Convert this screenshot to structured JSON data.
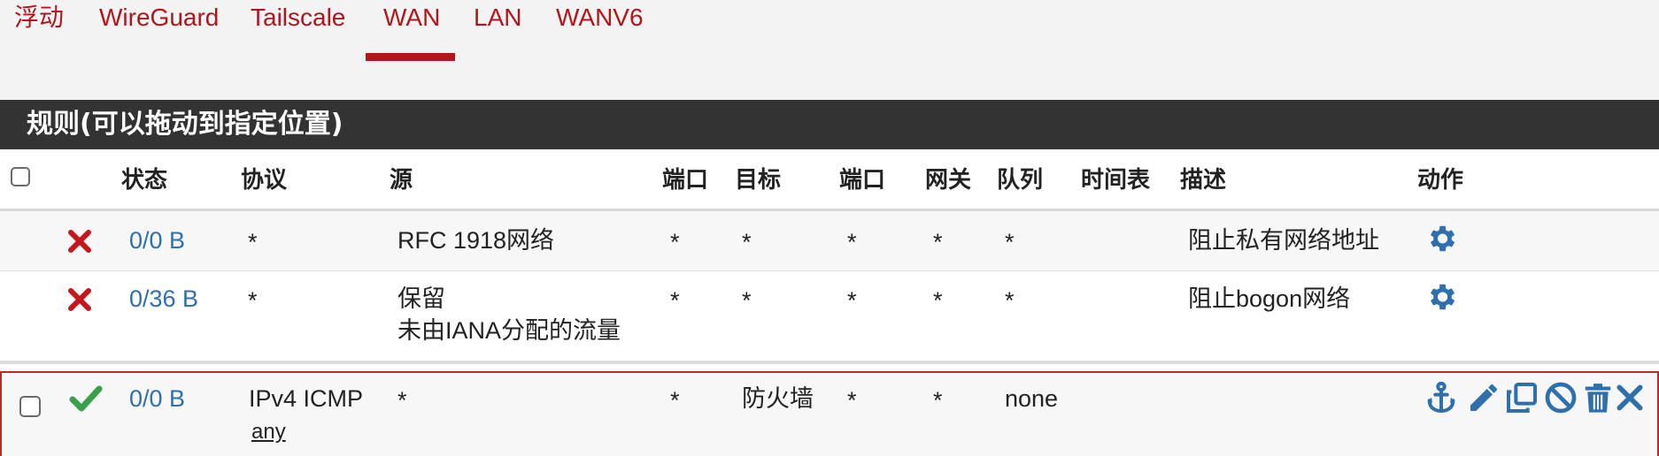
{
  "tabs": [
    {
      "label": "浮动"
    },
    {
      "label": "WireGuard"
    },
    {
      "label": "Tailscale"
    },
    {
      "label": "WAN",
      "active": true
    },
    {
      "label": "LAN"
    },
    {
      "label": "WANV6"
    }
  ],
  "panel": {
    "title": "规则(可以拖动到指定位置)"
  },
  "columns": {
    "status": "状态",
    "protocol": "协议",
    "source": "源",
    "source_port": "端口",
    "destination": "目标",
    "dest_port": "端口",
    "gateway": "网关",
    "queue": "队列",
    "schedule": "时间表",
    "description": "描述",
    "actions": "动作"
  },
  "rules": [
    {
      "status_icon": "block-x-icon",
      "states": "0/0 B",
      "protocol": "*",
      "source": "RFC 1918网络",
      "source_port": "*",
      "destination": "*",
      "dest_port": "*",
      "gateway": "*",
      "queue": "*",
      "schedule": "",
      "description": "阻止私有网络地址",
      "actions": [
        "gear-icon"
      ]
    },
    {
      "status_icon": "block-x-icon",
      "states": "0/36 B",
      "protocol": "*",
      "source_line1": "保留",
      "source_line2": "未由IANA分配的流量",
      "source_port": "*",
      "destination": "*",
      "dest_port": "*",
      "gateway": "*",
      "queue": "*",
      "schedule": "",
      "description": "阻止bogon网络",
      "actions": [
        "gear-icon"
      ]
    },
    {
      "status_icon": "pass-check-icon",
      "states": "0/0 B",
      "protocol": "IPv4 ICMP",
      "protocol_sub": "any",
      "source": "*",
      "source_port": "*",
      "destination": "防火墙",
      "dest_port": "*",
      "gateway": "*",
      "queue": "none",
      "schedule": "",
      "description": "",
      "actions": [
        "anchor-icon",
        "pencil-icon",
        "copy-icon",
        "disable-icon",
        "trash-icon",
        "delete-x-icon"
      ]
    }
  ],
  "colors": {
    "accent": "#b0161c",
    "heading_bg": "#333333",
    "link": "#2e6fad",
    "block": "#c4161c",
    "pass": "#3aa14a"
  }
}
